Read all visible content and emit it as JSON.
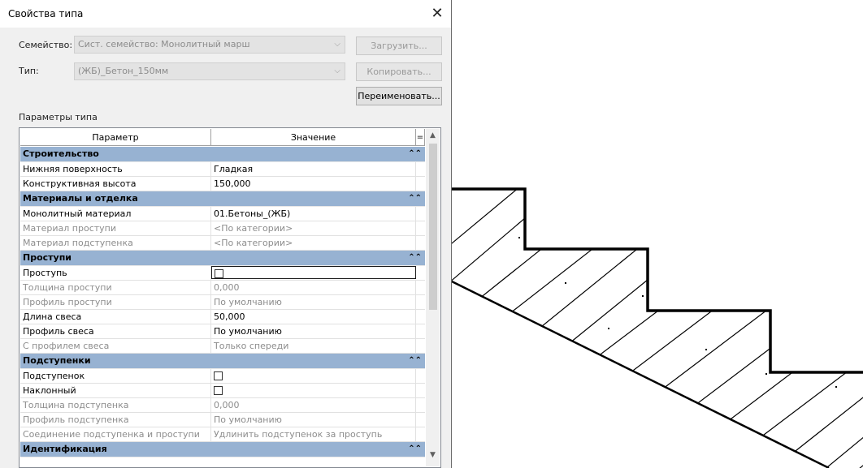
{
  "dialog": {
    "title": "Свойства типа",
    "family_label": "Семейство:",
    "family_value": "Сист. семейство: Монолитный марш",
    "type_label": "Тип:",
    "type_value": "(ЖБ)_Бетон_150мм",
    "load_button": "Загрузить...",
    "copy_button": "Копировать...",
    "rename_button": "Переименовать...",
    "section_label": "Параметры типа"
  },
  "grid": {
    "col_param": "Параметр",
    "col_value": "Значение",
    "col_sort": "=",
    "groups": [
      {
        "name": "Строительство",
        "rows": [
          {
            "name": "Нижняя поверхность",
            "value": "Гладкая"
          },
          {
            "name": "Конструктивная высота",
            "value": "150,000"
          }
        ]
      },
      {
        "name": "Материалы и отделка",
        "rows": [
          {
            "name": "Монолитный материал",
            "value": "01.Бетоны_(ЖБ)"
          },
          {
            "name": "Материал проступи",
            "value": "<По категории>"
          },
          {
            "name": "Материал подступенка",
            "value": "<По категории>"
          }
        ]
      },
      {
        "name": "Проступи",
        "rows": [
          {
            "name": "Проступь",
            "value": ""
          },
          {
            "name": "Толщина проступи",
            "value": "0,000"
          },
          {
            "name": "Профиль проступи",
            "value": "По умолчанию"
          },
          {
            "name": "Длина свеса",
            "value": "50,000"
          },
          {
            "name": "Профиль свеса",
            "value": "По умолчанию"
          },
          {
            "name": "С профилем свеса",
            "value": "Только спереди"
          }
        ]
      },
      {
        "name": "Подступенки",
        "rows": [
          {
            "name": "Подступенок",
            "value": ""
          },
          {
            "name": "Наклонный",
            "value": ""
          },
          {
            "name": "Толщина подступенка",
            "value": "0,000"
          },
          {
            "name": "Профиль подступенка",
            "value": "По умолчанию"
          },
          {
            "name": "Соединение подступенка и проступи",
            "value": "Удлинить подступенок за проступь"
          }
        ]
      },
      {
        "name": "Идентификация",
        "rows": []
      }
    ]
  },
  "icons": {
    "close": "close-icon",
    "dropdown": "chevron-down-icon",
    "collapse": "collapse-double-chevron-icon",
    "scroll_up": "scroll-up-arrow-icon",
    "scroll_down": "scroll-down-arrow-icon"
  },
  "colors": {
    "group_header": "#97b2d2",
    "dialog_bg": "#f0f0f0",
    "disabled_text": "#8d8d8d"
  }
}
